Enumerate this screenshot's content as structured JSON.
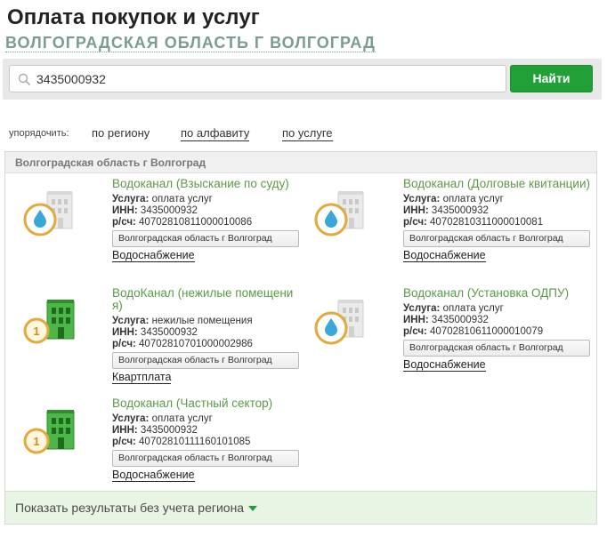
{
  "header": {
    "title": "Оплата покупок и услуг",
    "region": "ВОЛГОГРАДСКАЯ ОБЛАСТЬ Г ВОЛГОГРАД"
  },
  "search": {
    "value": "3435000932",
    "button_label": "Найти"
  },
  "sort": {
    "label": "упорядочить:",
    "options": [
      "по региону",
      "по алфавиту",
      "по услуге"
    ]
  },
  "results": {
    "group_title": "Волгоградская область г Волгоград",
    "cards": [
      {
        "title": "Водоканал (Взыскание по суду)",
        "service_label": "Услуга:",
        "service": "оплата услуг",
        "inn_label": "ИНН:",
        "inn": "3435000932",
        "account_label": "р/сч:",
        "account": "40702810811000010086",
        "region_button": "Волгоградская область г Волгоград",
        "category": "Водоснабжение",
        "icon": "water-drop-building-icon"
      },
      {
        "title": "Водоканал (Долговые квитанции)",
        "service_label": "Услуга:",
        "service": "оплата услуг",
        "inn_label": "ИНН:",
        "inn": "3435000932",
        "account_label": "р/сч:",
        "account": "40702810311000010081",
        "region_button": "Волгоградская область г Волгоград",
        "category": "Водоснабжение",
        "icon": "water-drop-building-icon"
      },
      {
        "title": "ВодоКанал (нежилые помещения)",
        "service_label": "Услуга:",
        "service": "нежилые помещения",
        "inn_label": "ИНН:",
        "inn": "3435000932",
        "account_label": "р/сч:",
        "account": "40702810701000002986",
        "region_button": "Волгоградская область г Волгоград",
        "category": "Квартплата",
        "icon": "green-building-coin-icon"
      },
      {
        "title": "Водоканал (Установка ОДПУ)",
        "service_label": "Услуга:",
        "service": "оплата услуг",
        "inn_label": "ИНН:",
        "inn": "3435000932",
        "account_label": "р/сч:",
        "account": "40702810611000010079",
        "region_button": "Волгоградская область г Волгоград",
        "category": "Водоснабжение",
        "icon": "water-drop-building-icon"
      },
      {
        "title": "Водоканал (Частный сектор)",
        "service_label": "Услуга:",
        "service": "оплата услуг",
        "inn_label": "ИНН:",
        "inn": "3435000932",
        "account_label": "р/сч:",
        "account": "40702810111160101085",
        "region_button": "Волгоградская область г Волгоград",
        "category": "Водоснабжение",
        "icon": "green-building-coin-icon"
      }
    ]
  },
  "footer": {
    "show_all_label": "Показать результаты без учета региона"
  },
  "colors": {
    "accent_green": "#21a038",
    "title_green": "#5a9a47",
    "region_gray_green": "#7a9d92",
    "footer_bg": "#e9f5e4",
    "drop_ring": "#e2a93b",
    "drop_blue": "#3aa7d9"
  }
}
